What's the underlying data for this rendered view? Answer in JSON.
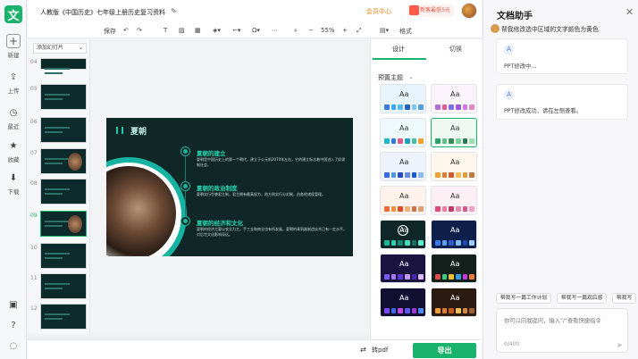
{
  "rail": {
    "logo": "文",
    "new_label": "新建",
    "upload_label": "上传",
    "recent_label": "最近",
    "fav_label": "收藏",
    "download_label": "下载"
  },
  "header": {
    "doc_title": "人教版《中国历史》七年级上册历史复习资料",
    "vip_label": "会员中心",
    "promo_label": "新客最低5元"
  },
  "toolbar": {
    "save_label": "保存",
    "zoom": "55%",
    "format_label": "格式"
  },
  "slides_panel": {
    "add_label": "添加幻灯片",
    "numbers": [
      "04",
      "05",
      "06",
      "07",
      "08",
      "09",
      "10",
      "11",
      "12"
    ]
  },
  "slide": {
    "title": "夏朝",
    "items": [
      {
        "heading": "夏朝的建立",
        "body": "夏朝是中国历史上的第一个朝代，建立于公元前2070年左右，它的建立标志着中国进入了奴隶制社会。"
      },
      {
        "heading": "夏朝的政治制度",
        "body": "夏朝实行世袭君主制，君主拥有最高权力，地方则实行分封制，由各地诸侯管理。"
      },
      {
        "heading": "夏朝的经济和文化",
        "body": "夏朝的经济主要以农业为主，手工业和商业也有所发展，夏朝的青铜器制造技术已有一定水平，对后世文化影响深远。"
      }
    ]
  },
  "design_panel": {
    "tab_design": "设计",
    "tab_switch": "切换",
    "preset_label": "预置主题",
    "theme_label": "Aa",
    "themes": [
      {
        "bg": "#e8f4fb",
        "dark": false,
        "sw": [
          "#3b7be0",
          "#3aa7e6",
          "#58b8f0",
          "#2a5fc2",
          "#7fc4ea",
          "#5a9ce0"
        ]
      },
      {
        "bg": "#fbf3fb",
        "dark": false,
        "sw": [
          "#b56ed8",
          "#e05a9a",
          "#7e6ee0",
          "#9e5ad0",
          "#d07ae0",
          "#e08ac0"
        ]
      },
      {
        "bg": "#eef9fb",
        "dark": false,
        "sw": [
          "#1fb7c9",
          "#2f7ae0",
          "#e05a8a",
          "#20a0c0",
          "#46c0a0",
          "#f0a030"
        ]
      },
      {
        "bg": "#f0f9f1",
        "dark": false,
        "sw": [
          "#2aa16a",
          "#5cc08a",
          "#3a8a5a",
          "#7ad0a0",
          "#2f7a50",
          "#9ae0b0"
        ]
      },
      {
        "bg": "#eef2fb",
        "dark": false,
        "sw": [
          "#3a6ae0",
          "#4a9ae0",
          "#2a4ac0",
          "#6a8ae0",
          "#1a5ad0",
          "#8abaf0"
        ]
      },
      {
        "bg": "#fff7ec",
        "dark": false,
        "sw": [
          "#f0a030",
          "#e07a30",
          "#d05a30",
          "#f0c060",
          "#e09a40",
          "#c07a40"
        ]
      },
      {
        "bg": "#fff1ec",
        "dark": false,
        "sw": [
          "#f06a3a",
          "#f0903a",
          "#e04a2a",
          "#f0b07a",
          "#d07050",
          "#e0a070"
        ]
      },
      {
        "bg": "#fdf0f4",
        "dark": false,
        "sw": [
          "#e04a7a",
          "#f07aa0",
          "#c03a6a",
          "#e090b0",
          "#d05a8a",
          "#f0a0c0"
        ]
      },
      {
        "bg": "#0f2726",
        "dark": true,
        "sw": [
          "#1bb79c",
          "#2ad0b0",
          "#0f8a7a",
          "#3ae0c0",
          "#1a6a60",
          "#5af0d0"
        ]
      },
      {
        "bg": "#0d1f4a",
        "dark": true,
        "sw": [
          "#3a7af0",
          "#5aa0f0",
          "#2a5ad0",
          "#7abaf0",
          "#1a4ab0",
          "#9ad0ff"
        ]
      },
      {
        "bg": "#1c1440",
        "dark": true,
        "sw": [
          "#7a5af0",
          "#a07af0",
          "#5a3ad0",
          "#c09af0",
          "#4a2ab0",
          "#e0baff"
        ]
      },
      {
        "bg": "#14201c",
        "dark": true,
        "sw": [
          "#e04a4a",
          "#3ad07a",
          "#f0c03a",
          "#3a9ae0",
          "#c03ae0",
          "#f07a3a"
        ]
      },
      {
        "bg": "#120f30",
        "dark": true,
        "sw": [
          "#7a4af0",
          "#3a6ae0",
          "#c04ae0",
          "#5a5af0",
          "#9a3ad0",
          "#4a8af0"
        ]
      },
      {
        "bg": "#2a1a10",
        "dark": true,
        "sw": [
          "#f0a030",
          "#e07a30",
          "#c05a20",
          "#f0c060",
          "#d08a40",
          "#a06030"
        ]
      }
    ]
  },
  "bottom": {
    "topdf_label": "转pdf",
    "export_label": "导出"
  },
  "assistant": {
    "title": "文档助手",
    "user_message": "帮我修改选中区域的文字颜色为黄色",
    "reply1": "PPT修改中...",
    "reply2": "PPT修改成功，请在左侧查看。",
    "chips": [
      "帮我写一篇工作计划",
      "帮我写一篇观后感",
      "帮我写"
    ],
    "input_placeholder": "你可以向我提问，输入\"/\"查看快捷指令",
    "counter": "0/400"
  }
}
